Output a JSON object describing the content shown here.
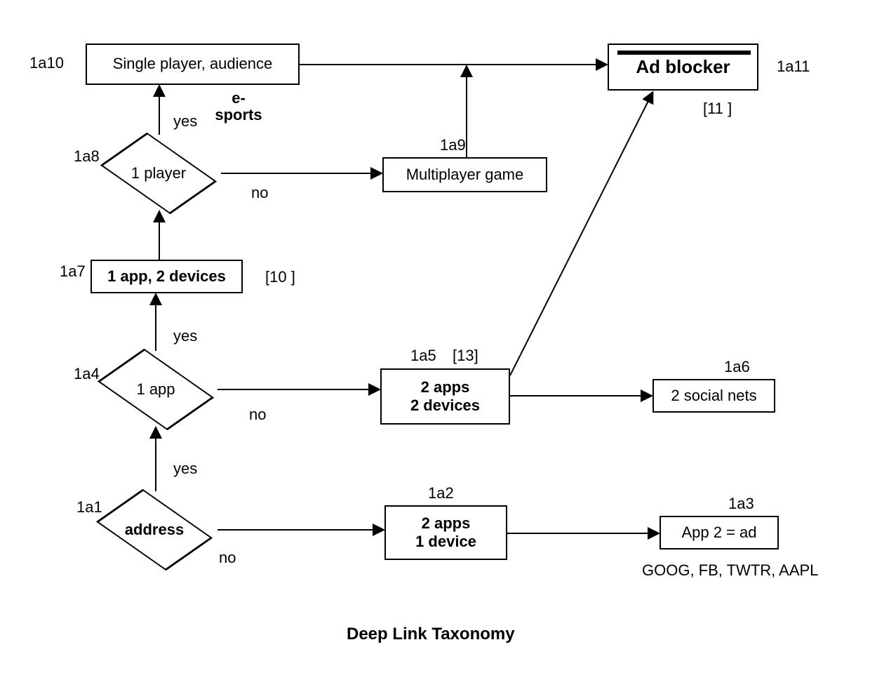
{
  "title": "Deep Link Taxonomy",
  "nodes": {
    "a1": {
      "ref": "1a1",
      "label": "address",
      "yes": "yes",
      "no": "no"
    },
    "a2": {
      "ref": "1a2",
      "label": "2 apps\n1 device"
    },
    "a3": {
      "ref": "1a3",
      "label": "App 2 = ad",
      "sub": "GOOG, FB, TWTR, AAPL"
    },
    "a4": {
      "ref": "1a4",
      "label": "1 app",
      "yes": "yes",
      "no": "no"
    },
    "a5": {
      "ref": "1a5",
      "label": "2 apps\n2 devices",
      "bracket": "[13]"
    },
    "a6": {
      "ref": "1a6",
      "label": "2 social nets"
    },
    "a7": {
      "ref": "1a7",
      "label": "1 app, 2 devices",
      "bracket": "[10 ]"
    },
    "a8": {
      "ref": "1a8",
      "label": "1 player",
      "yes": "yes",
      "no": "no",
      "esports": "e-\nsports"
    },
    "a9": {
      "ref": "1a9",
      "label": "Multiplayer game"
    },
    "a10": {
      "ref": "1a10",
      "label": "Single player, audience"
    },
    "a11": {
      "ref": "1a11",
      "label": "Ad blocker",
      "bracket": "[11 ]"
    }
  }
}
